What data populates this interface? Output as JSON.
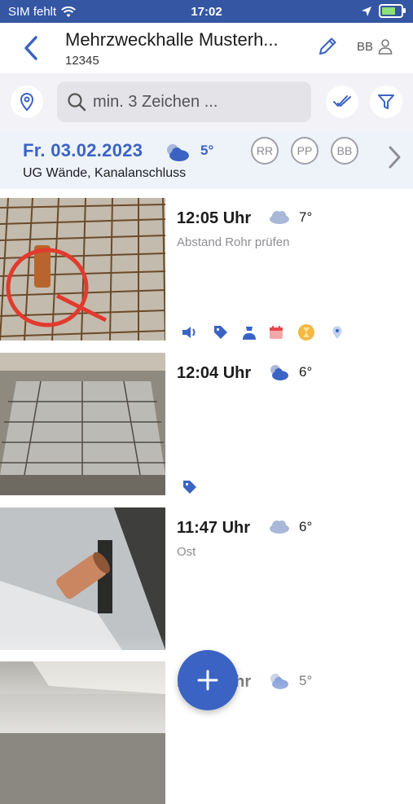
{
  "status_bar": {
    "carrier": "SIM fehlt",
    "time": "17:02"
  },
  "header": {
    "title": "Mehrzweckhalle Musterh...",
    "subtitle": "12345",
    "user_initials": "BB"
  },
  "search": {
    "placeholder": "min. 3 Zeichen ..."
  },
  "day": {
    "date": "Fr. 03.02.2023",
    "temp": "5°",
    "description": "UG Wände, Kanalanschluss",
    "participants": [
      "RR",
      "PP",
      "BB"
    ]
  },
  "entries": [
    {
      "time": "12:05 Uhr",
      "temp": "7°",
      "note": "Abstand Rohr prüfen",
      "weather": "cloud-icon",
      "icons": [
        "speaker-icon",
        "tag-icon",
        "person-icon",
        "calendar-icon",
        "hourglass-icon",
        "location-pin-icon"
      ]
    },
    {
      "time": "12:04 Uhr",
      "temp": "6°",
      "note": "",
      "weather": "sun-cloud-icon",
      "icons": [
        "tag-icon"
      ]
    },
    {
      "time": "11:47 Uhr",
      "temp": "6°",
      "note": "Ost",
      "weather": "cloud-icon",
      "icons": []
    },
    {
      "time": "12:01 Uhr",
      "temp": "5°",
      "note": "",
      "weather": "sun-cloud-icon",
      "icons": []
    }
  ],
  "colors": {
    "primary": "#3a63c4",
    "status_bar": "#3456a3",
    "day_header_bg": "#eef3fa",
    "search_bg": "#f2f2f7"
  }
}
